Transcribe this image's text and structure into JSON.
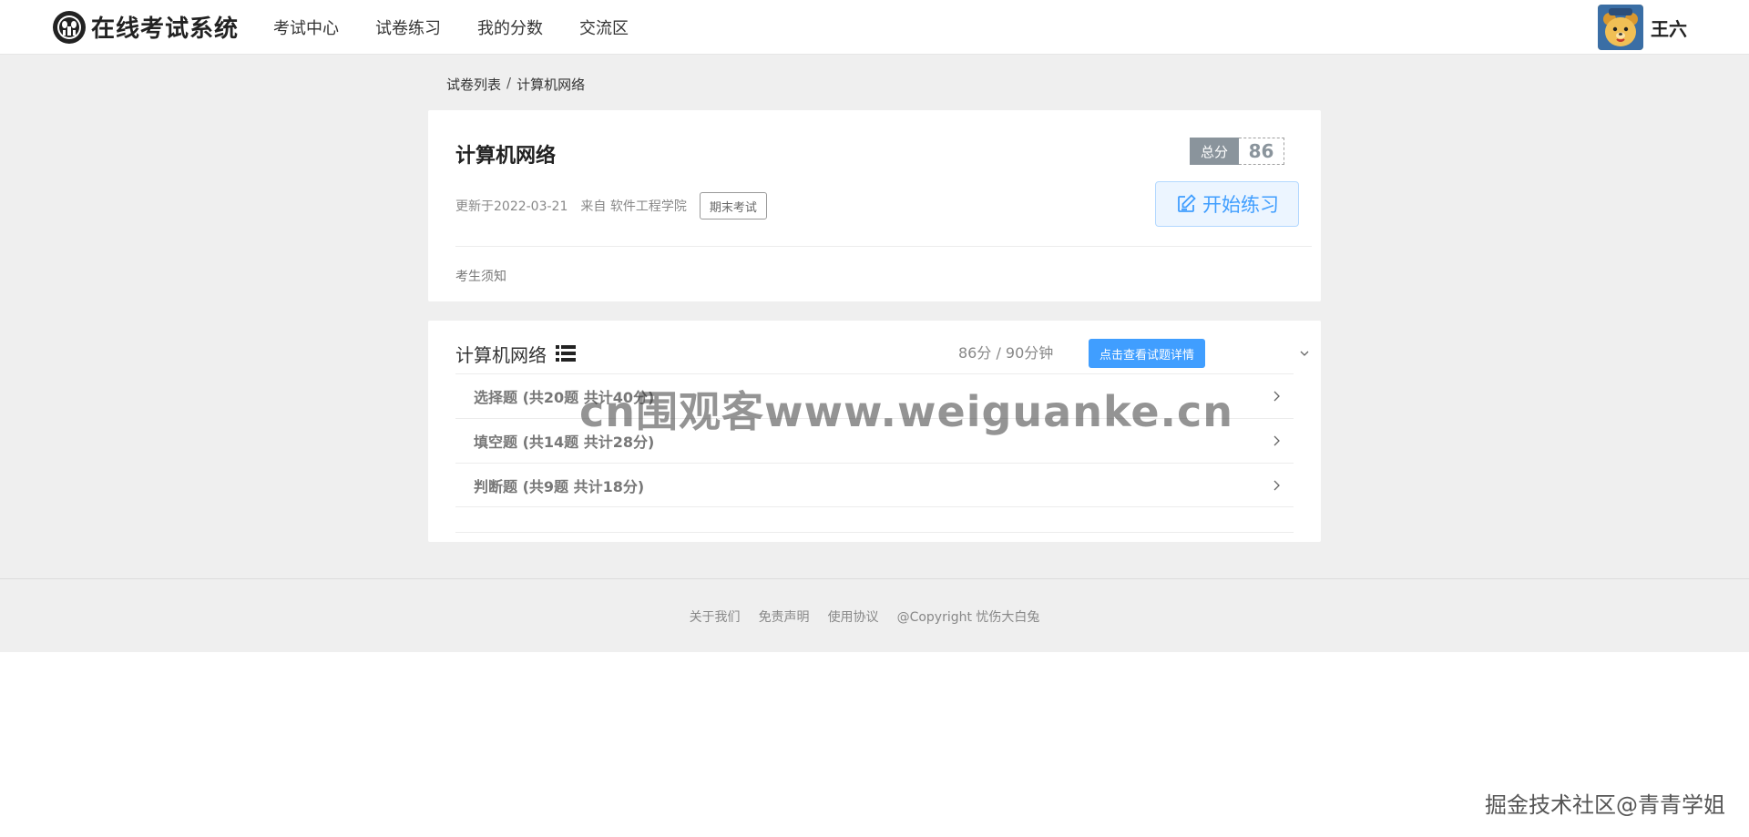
{
  "header": {
    "app_title": "在线考试系统",
    "nav": [
      "考试中心",
      "试卷练习",
      "我的分数",
      "交流区"
    ],
    "username": "王六",
    "logo_icon": "panda-logo-icon",
    "avatar_icon": "bear-avatar"
  },
  "breadcrumb": {
    "items": [
      "试卷列表",
      "计算机网络"
    ],
    "separator": "/"
  },
  "exam": {
    "title": "计算机网络",
    "updated": "更新于2022-03-21",
    "source": "来自 软件工程学院",
    "tag": "期末考试",
    "score_label": "总分",
    "score_value": "86",
    "start_label": "开始练习",
    "notice": "考生须知"
  },
  "paper": {
    "title": "计算机网络",
    "score_time": "86分 / 90分钟",
    "detail_label": "点击查看试题详情",
    "sections": [
      {
        "label": "选择题 (共20题 共计40分)"
      },
      {
        "label": "填空题 (共14题 共计28分)"
      },
      {
        "label": "判断题 (共9题 共计18分)"
      }
    ]
  },
  "footer": {
    "links": [
      "关于我们",
      "免责声明",
      "使用协议",
      "@Copyright 忧伤大白兔"
    ]
  },
  "watermarks": {
    "center": "cn围观客www.weiguanke.cn",
    "corner": "掘金技术社区@青青学姐"
  },
  "colors": {
    "primary": "#409eff",
    "primary_light": "#ecf5ff",
    "score_gray": "#8a949c",
    "band_bg": "#efefef"
  }
}
